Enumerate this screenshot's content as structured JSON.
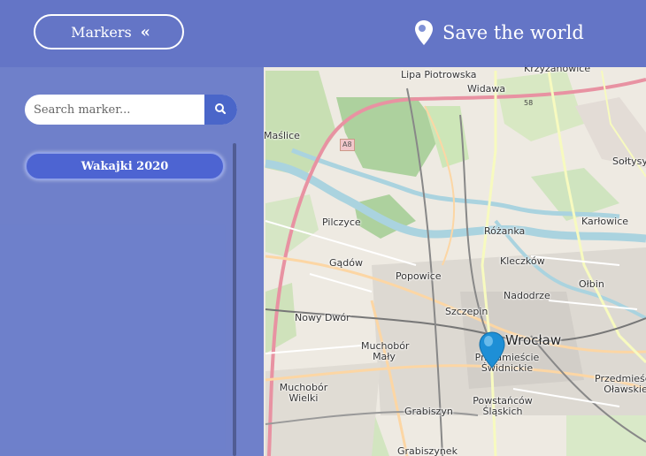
{
  "header": {
    "markers_label": "Markers",
    "markers_chevron": "«",
    "title": "Save the world"
  },
  "sidebar": {
    "search_placeholder": "Search marker...",
    "items": [
      {
        "label": "Wakajki 2020"
      }
    ]
  },
  "map": {
    "labels": {
      "krzyzanowice": "Krzyżanowice",
      "lipa": "Lipa Piotrowska",
      "widawa": "Widawa",
      "maslice": "Maślice",
      "a8": "A8",
      "r58": "58",
      "soltysowice": "Sołtysy",
      "pilczyce": "Pilczyce",
      "rozanka": "Różanka",
      "karlowice": "Karłowice",
      "gadow": "Gądów",
      "kleczkow": "Kleczków",
      "popowice": "Popowice",
      "olbin": "Ołbin",
      "nadodrze": "Nadodrze",
      "nowy_dwor": "Nowy Dwór",
      "szczepin": "Szczepin",
      "wroclaw": "Wrocław",
      "muchobor_maly": "Muchobór Mały",
      "przedmiescie_swidnickie": "Przedmieście Świdnickie",
      "przedmiescie_olawskie": "Przedmieście Oławskie",
      "muchobor_wielki": "Muchobór Wielki",
      "powstancow": "Powstańców Śląskich",
      "grabiszyn": "Grabiszyn",
      "grabiszynek": "Grabiszynek"
    },
    "marker_color": "#1e8fd6"
  },
  "colors": {
    "header_bg": "#596cc4",
    "sidebar_bg": "#6074c8",
    "accent": "#4a66c9",
    "river": "#aad3df",
    "forest": "#add19e",
    "motorway": "#e892a2",
    "primary_road": "#fcd6a4"
  }
}
